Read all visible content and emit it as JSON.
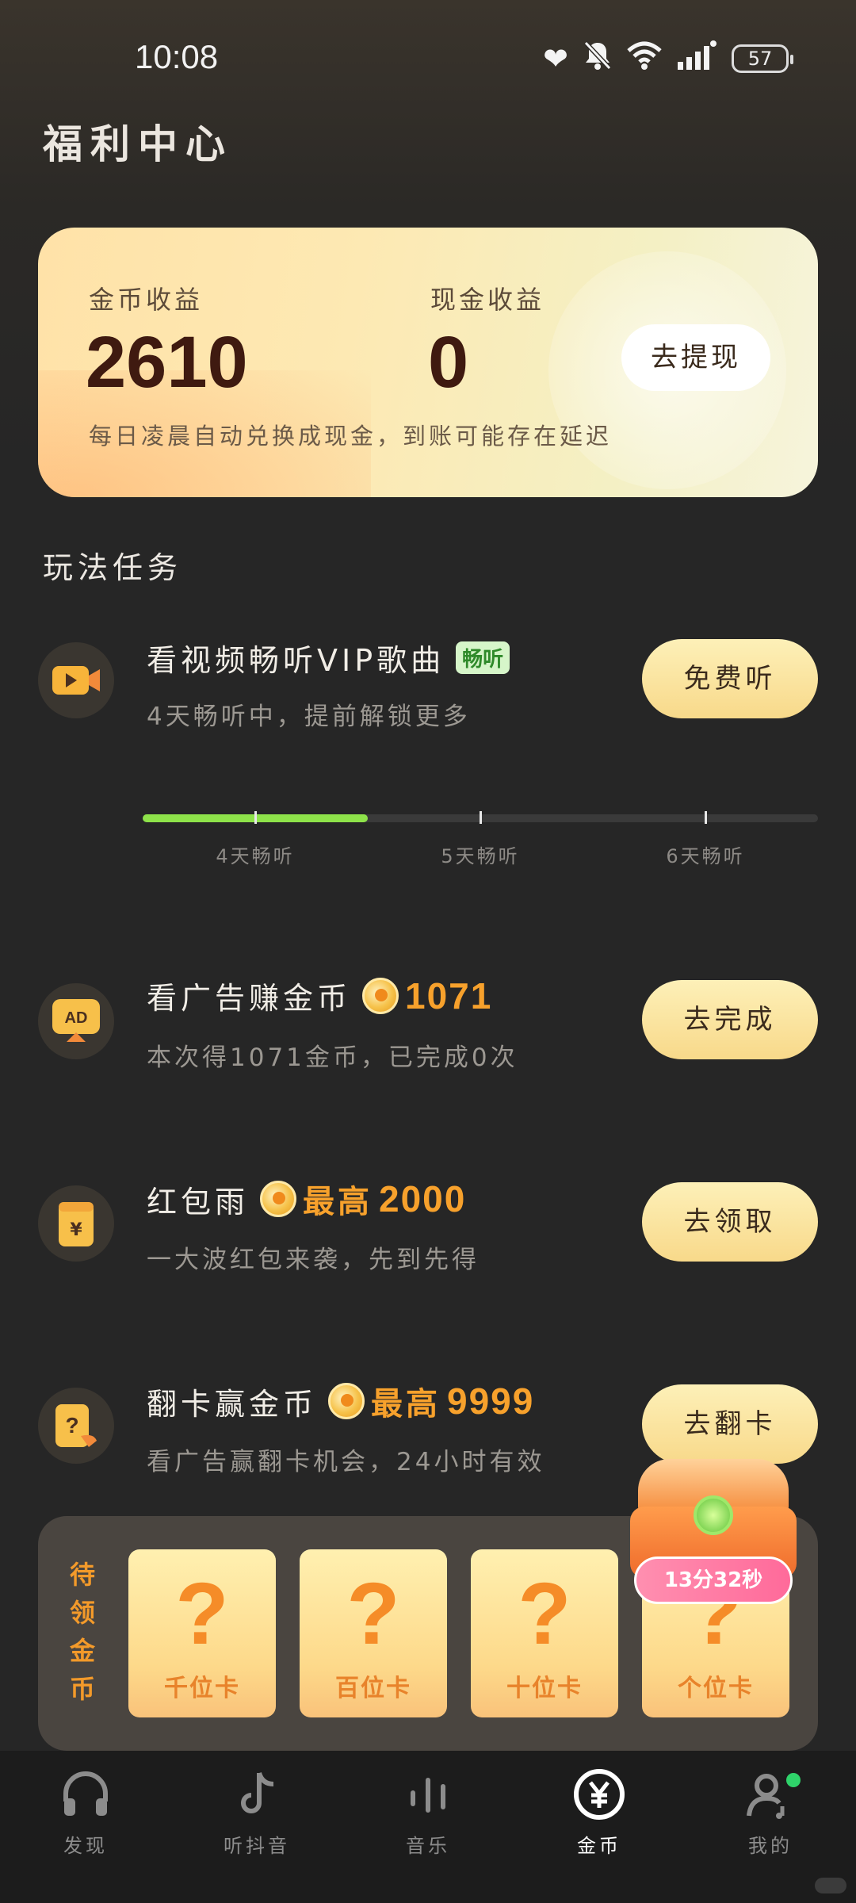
{
  "status_bar": {
    "time": "10:08",
    "battery": "57"
  },
  "page": {
    "title": "福利中心"
  },
  "earnings": {
    "coin_label": "金币收益",
    "coin_value": "2610",
    "cash_label": "现金收益",
    "cash_value": "0",
    "withdraw_button": "去提现",
    "note": "每日凌晨自动兑换成现金，到账可能存在延迟"
  },
  "tasks_section": {
    "title": "玩法任务"
  },
  "tasks": [
    {
      "title": "看视频畅听VIP歌曲",
      "tag": "畅听",
      "subtitle": "4天畅听中，提前解锁更多",
      "button": "免费听",
      "icon": "video-play-icon"
    },
    {
      "title": "看广告赚金币",
      "reward": "1071",
      "subtitle": "本次得1071金币，已完成0次",
      "button": "去完成",
      "icon": "ad-icon"
    },
    {
      "title": "红包雨",
      "reward_prefix": "最高",
      "reward": "2000",
      "subtitle": "一大波红包来袭，先到先得",
      "button": "去领取",
      "icon": "red-envelope-icon"
    },
    {
      "title": "翻卡赢金币",
      "reward_prefix": "最高",
      "reward": "9999",
      "subtitle": "看广告赢翻卡机会，24小时有效",
      "button": "去翻卡",
      "icon": "flip-card-icon"
    }
  ],
  "progress": {
    "fraction": 0.333,
    "labels": [
      "4天畅听",
      "5天畅听",
      "6天畅听"
    ],
    "fill_color": "#8ee24a"
  },
  "pending_coins": {
    "label": "待领金币",
    "cards": [
      {
        "mark": "?",
        "label": "千位卡"
      },
      {
        "mark": "?",
        "label": "百位卡"
      },
      {
        "mark": "?",
        "label": "十位卡"
      },
      {
        "mark": "?",
        "label": "个位卡"
      }
    ],
    "timer": "13分32秒"
  },
  "nav": [
    {
      "label": "发现",
      "icon": "headphones-icon"
    },
    {
      "label": "听抖音",
      "icon": "tiktok-icon"
    },
    {
      "label": "音乐",
      "icon": "music-bars-icon"
    },
    {
      "label": "金币",
      "icon": "yuan-coin-icon",
      "active": true
    },
    {
      "label": "我的",
      "icon": "profile-icon"
    }
  ],
  "colors": {
    "accent_orange": "#f7a12c",
    "button_yellow": "#f8d98a",
    "nav_active": "#ffffff"
  }
}
